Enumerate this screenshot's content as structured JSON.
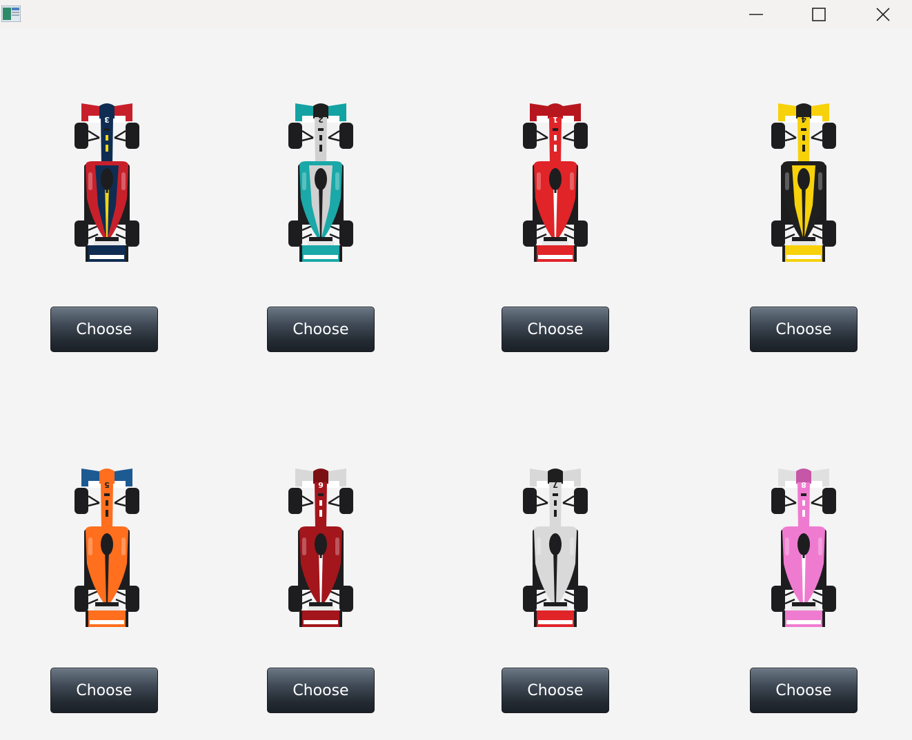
{
  "window": {
    "controls": [
      "minimize-icon",
      "maximize-icon",
      "close-icon"
    ]
  },
  "cars": [
    {
      "number": "3",
      "nose": "#c8202b",
      "body": "#0f2d52",
      "side": "#c8202b",
      "stripe": "#f2d417",
      "rear": "#0f2d52",
      "halo": "#0f2d52",
      "choose_label": "Choose"
    },
    {
      "number": "2",
      "nose": "#14a3a3",
      "body": "#d0d0d0",
      "side": "#1aa8a8",
      "stripe": "#1f1f1f",
      "rear": "#1aa8a8",
      "halo": "#1f1f1f",
      "choose_label": "Choose"
    },
    {
      "number": "1",
      "nose": "#b8161e",
      "body": "#e02428",
      "side": "#e02428",
      "stripe": "#ffffff",
      "rear": "#e02428",
      "halo": "#b8161e",
      "choose_label": "Choose"
    },
    {
      "number": "4",
      "nose": "#f7d10a",
      "body": "#f7d10a",
      "side": "#1f1f1f",
      "stripe": "#1f1f1f",
      "rear": "#f7d10a",
      "halo": "#1f1f1f",
      "choose_label": "Choose"
    },
    {
      "number": "5",
      "nose": "#1d5a92",
      "body": "#ff6f1e",
      "side": "#ff6f1e",
      "stripe": "#1f1f1f",
      "rear": "#ff6f1e",
      "halo": "#ff6f1e",
      "choose_label": "Choose"
    },
    {
      "number": "6",
      "nose": "#d8d8d8",
      "body": "#a3161c",
      "side": "#a3161c",
      "stripe": "#ffffff",
      "rear": "#a3161c",
      "halo": "#7c0f14",
      "choose_label": "Choose"
    },
    {
      "number": "7",
      "nose": "#d8d8d8",
      "body": "#d9d9d9",
      "side": "#d9d9d9",
      "stripe": "#1f1f1f",
      "rear": "#e02428",
      "halo": "#1f1f1f",
      "choose_label": "Choose"
    },
    {
      "number": "8",
      "nose": "#e0e0e0",
      "body": "#ef7bd0",
      "side": "#ef7bd0",
      "stripe": "#ffffff",
      "rear": "#ef7bd0",
      "halo": "#c556a8",
      "choose_label": "Choose"
    }
  ]
}
